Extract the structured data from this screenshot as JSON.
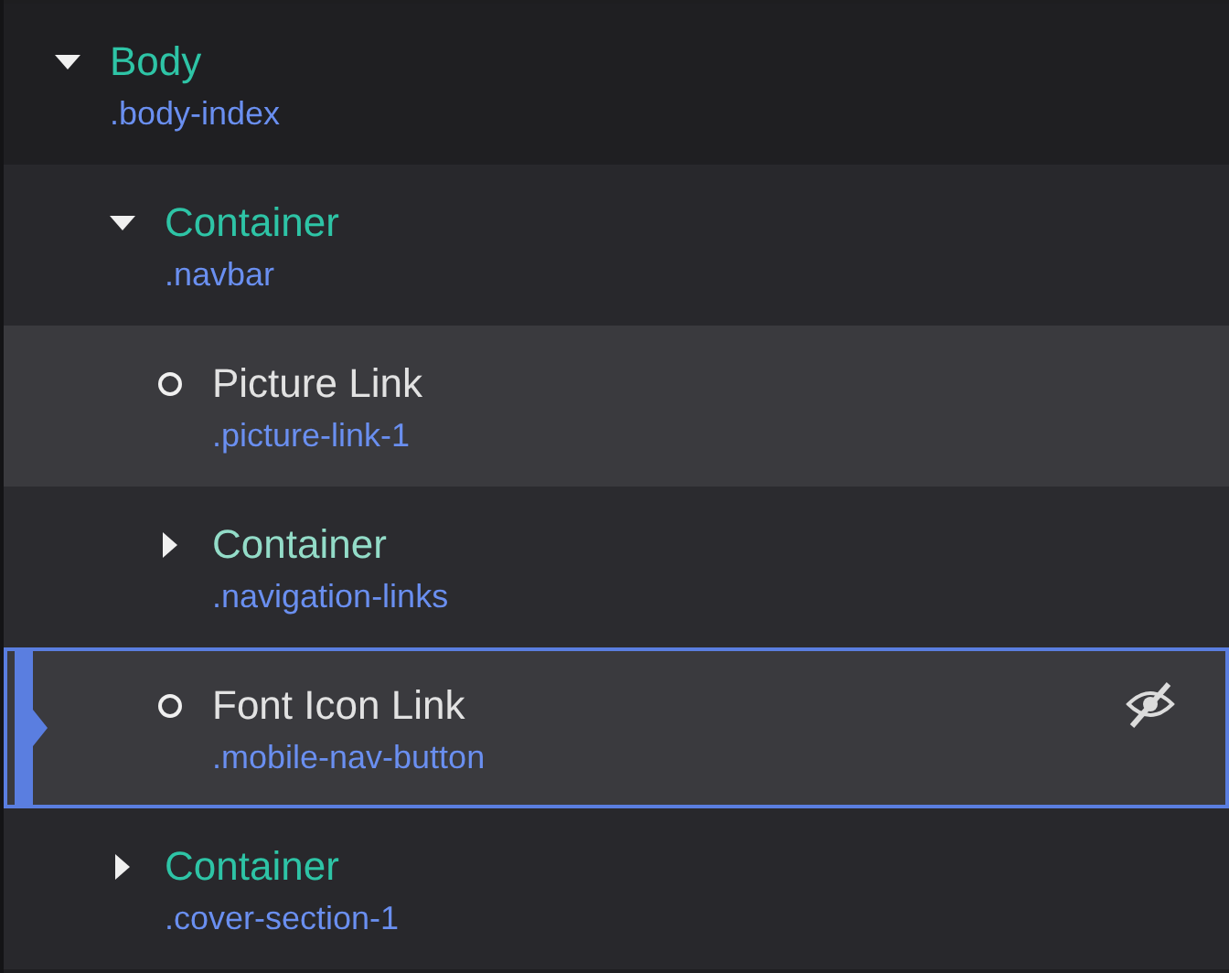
{
  "tree": [
    {
      "kind": "container",
      "title": "Body",
      "class_name": ".body-index",
      "color": "#2ec4a6",
      "expanded": true,
      "selected": false,
      "hovered": false,
      "hidden": false,
      "children": [
        {
          "kind": "container",
          "title": "Container",
          "class_name": ".navbar",
          "color": "#2ec4a6",
          "expanded": true,
          "selected": false,
          "hovered": false,
          "hidden": false,
          "children": [
            {
              "kind": "element",
              "title": "Picture Link",
              "class_name": ".picture-link-1",
              "color": "#e2e2e2",
              "selected": false,
              "hovered": true,
              "hidden": false
            },
            {
              "kind": "container",
              "title": "Container",
              "class_name": ".navigation-links",
              "color": "#93dcc8",
              "expanded": false,
              "selected": false,
              "hovered": false,
              "hidden": false
            },
            {
              "kind": "element",
              "title": "Font Icon Link",
              "class_name": ".mobile-nav-button",
              "color": "#e2e2e2",
              "selected": true,
              "hovered": false,
              "hidden": true
            }
          ]
        },
        {
          "kind": "container",
          "title": "Container",
          "class_name": ".cover-section-1",
          "color": "#2ec4a6",
          "expanded": false,
          "selected": false,
          "hovered": false,
          "hidden": false
        }
      ]
    }
  ]
}
